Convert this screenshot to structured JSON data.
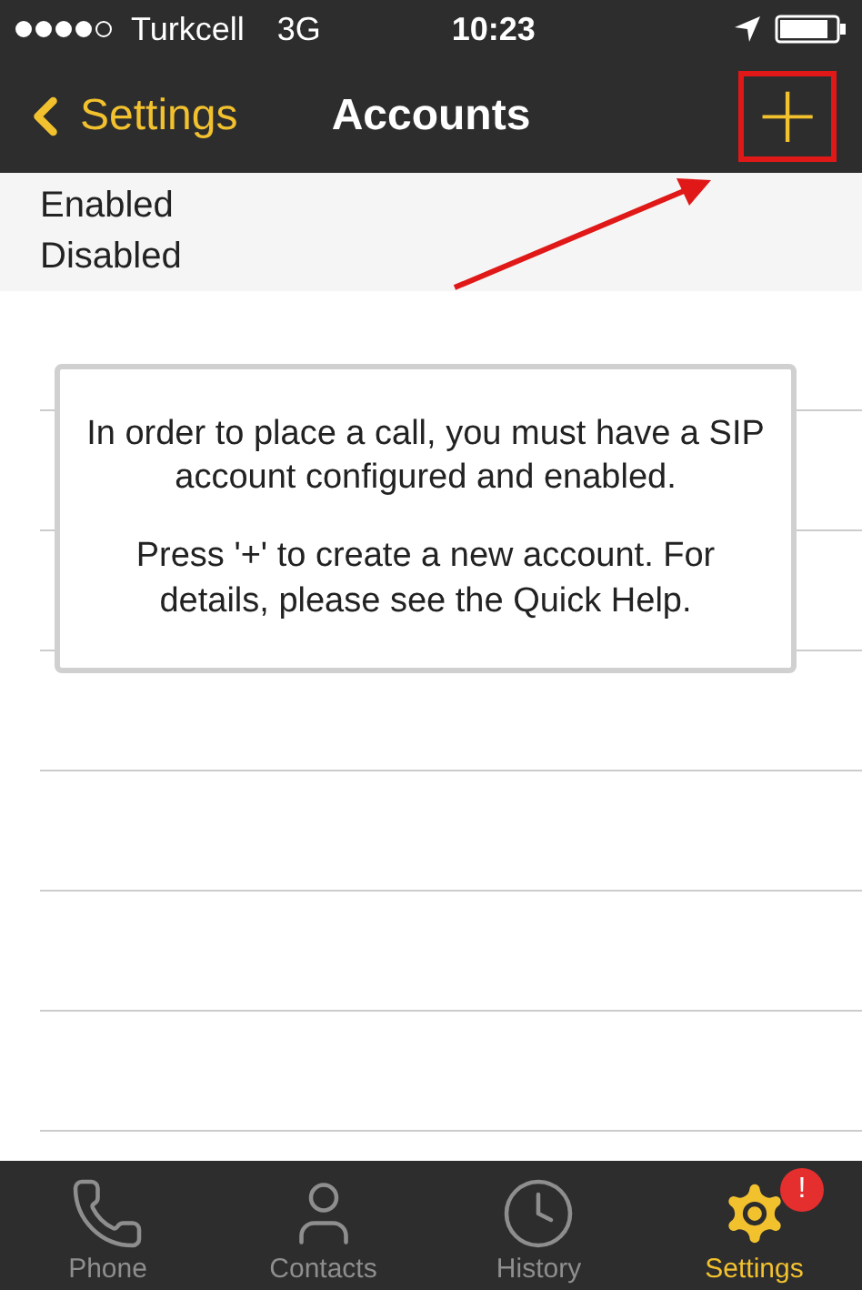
{
  "status_bar": {
    "carrier": "Turkcell",
    "network": "3G",
    "time": "10:23"
  },
  "nav_bar": {
    "back_label": "Settings",
    "title": "Accounts",
    "add_button": "+"
  },
  "sections": [
    "Enabled",
    "Disabled"
  ],
  "message": {
    "paragraphs": [
      "In order to place a call, you must have a SIP account configured and enabled.",
      "Press '+' to create a new account. For details, please see the Quick Help."
    ]
  },
  "tab_bar": [
    {
      "label": "Phone",
      "kind": "phone",
      "selected": false
    },
    {
      "label": "Contacts",
      "kind": "contacts",
      "selected": false
    },
    {
      "label": "History",
      "kind": "history",
      "selected": false
    },
    {
      "label": "Settings",
      "kind": "settings",
      "selected": true,
      "badge": "!"
    }
  ]
}
